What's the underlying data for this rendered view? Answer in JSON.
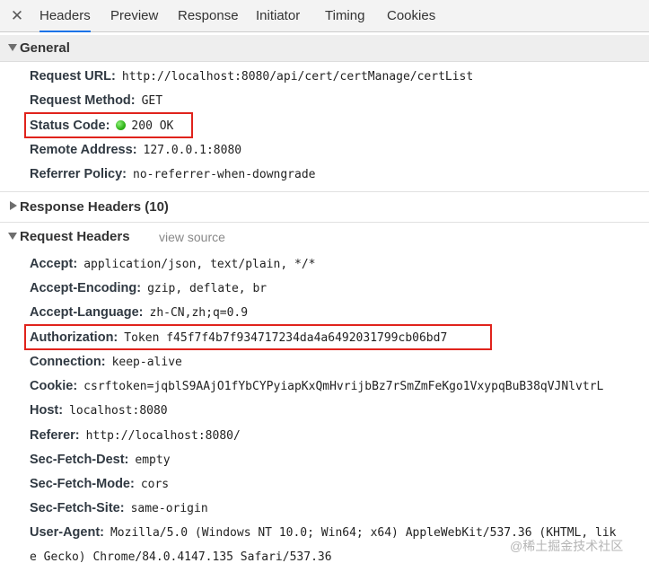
{
  "tabs": {
    "close_glyph": "✕",
    "items": [
      {
        "label": "Headers",
        "active": true
      },
      {
        "label": "Preview"
      },
      {
        "label": "Response"
      },
      {
        "label": "Initiator"
      },
      {
        "label": "Timing"
      },
      {
        "label": "Cookies"
      }
    ]
  },
  "general": {
    "title": "General",
    "request_url": {
      "key": "Request URL:",
      "value": "http://localhost:8080/api/cert/certManage/certList"
    },
    "request_method": {
      "key": "Request Method:",
      "value": "GET"
    },
    "status_code": {
      "key": "Status Code:",
      "value": "200 OK",
      "status_color": "#2fb317"
    },
    "remote_address": {
      "key": "Remote Address:",
      "value": "127.0.0.1:8080"
    },
    "referrer_policy": {
      "key": "Referrer Policy:",
      "value": "no-referrer-when-downgrade"
    }
  },
  "response_headers": {
    "title": "Response Headers (10)"
  },
  "request_headers": {
    "title": "Request Headers",
    "view_source": "view source",
    "accept": {
      "key": "Accept:",
      "value": "application/json, text/plain, */*"
    },
    "accept_encoding": {
      "key": "Accept-Encoding:",
      "value": "gzip, deflate, br"
    },
    "accept_language": {
      "key": "Accept-Language:",
      "value": "zh-CN,zh;q=0.9"
    },
    "authorization": {
      "key": "Authorization:",
      "value": "Token f45f7f4b7f934717234da4a6492031799cb06bd7"
    },
    "connection": {
      "key": "Connection:",
      "value": "keep-alive"
    },
    "cookie": {
      "key": "Cookie:",
      "value": "csrftoken=jqblS9AAjO1fYbCYPyiapKxQmHvrijbBz7rSmZmFeKgo1VxypqBuB38qVJNlvtrL"
    },
    "host": {
      "key": "Host:",
      "value": "localhost:8080"
    },
    "referer": {
      "key": "Referer:",
      "value": "http://localhost:8080/"
    },
    "sec_fetch_dest": {
      "key": "Sec-Fetch-Dest:",
      "value": "empty"
    },
    "sec_fetch_mode": {
      "key": "Sec-Fetch-Mode:",
      "value": "cors"
    },
    "sec_fetch_site": {
      "key": "Sec-Fetch-Site:",
      "value": "same-origin"
    },
    "user_agent": {
      "key": "User-Agent:",
      "value_line1": "Mozilla/5.0 (Windows NT 10.0; Win64; x64) AppleWebKit/537.36 (KHTML, lik",
      "value_line2": "e Gecko) Chrome/84.0.4147.135 Safari/537.36"
    }
  },
  "watermark": "@稀土掘金技术社区",
  "colors": {
    "highlight": "#e0231c",
    "active_tab": "#1a73e8"
  }
}
